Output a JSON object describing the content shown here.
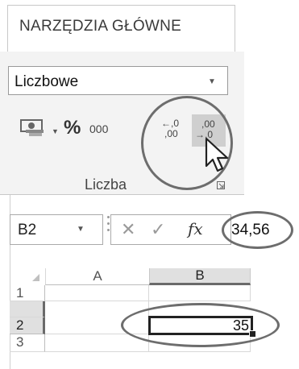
{
  "ribbon": {
    "tab_label": "NARZĘDZIA GŁÓWNE",
    "number_format": "Liczbowe",
    "percent_label": "%",
    "comma_label": "000",
    "increase_decimal": {
      "top": "←,0",
      "bottom": ",00"
    },
    "decrease_decimal": {
      "top": ",00",
      "bottom": "→,0"
    },
    "group_label": "Liczba"
  },
  "formula_bar": {
    "name_box": "B2",
    "cancel_symbol": "✕",
    "enter_symbol": "✓",
    "fx_label": "fx",
    "formula_value": "34,56"
  },
  "grid": {
    "columns": [
      "A",
      "B"
    ],
    "rows": [
      "1",
      "2",
      "3"
    ],
    "selected_cell_value": "35"
  },
  "colors": {
    "highlight_circle": "#6d6d6d",
    "selection": "#222222",
    "header_selected": "#e0e0e0"
  }
}
